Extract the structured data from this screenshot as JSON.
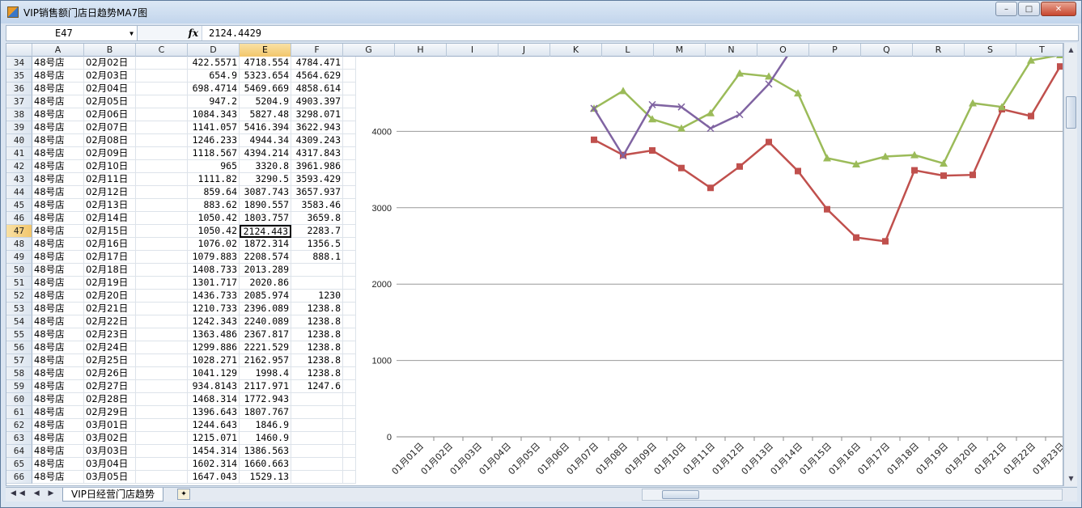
{
  "window": {
    "title": "VIP销售额门店日趋势MA7图",
    "min": "–",
    "max": "□",
    "close": "✕"
  },
  "formula": {
    "cell_ref": "E47",
    "value": "2124.4429",
    "fx": "fx"
  },
  "columns": [
    "A",
    "B",
    "C",
    "D",
    "E",
    "F",
    "G",
    "H",
    "I",
    "J",
    "K",
    "L",
    "M",
    "N",
    "O",
    "P",
    "Q",
    "R",
    "S",
    "T"
  ],
  "selected_column": "E",
  "rows": [
    {
      "n": "34",
      "a": "48号店",
      "b": "02月02日",
      "d": "422.5571",
      "e": "4718.554",
      "f": "4784.471"
    },
    {
      "n": "35",
      "a": "48号店",
      "b": "02月03日",
      "d": "654.9",
      "e": "5323.654",
      "f": "4564.629"
    },
    {
      "n": "36",
      "a": "48号店",
      "b": "02月04日",
      "d": "698.4714",
      "e": "5469.669",
      "f": "4858.614"
    },
    {
      "n": "37",
      "a": "48号店",
      "b": "02月05日",
      "d": "947.2",
      "e": "5204.9",
      "f": "4903.397"
    },
    {
      "n": "38",
      "a": "48号店",
      "b": "02月06日",
      "d": "1084.343",
      "e": "5827.48",
      "f": "3298.071"
    },
    {
      "n": "39",
      "a": "48号店",
      "b": "02月07日",
      "d": "1141.057",
      "e": "5416.394",
      "f": "3622.943"
    },
    {
      "n": "40",
      "a": "48号店",
      "b": "02月08日",
      "d": "1246.233",
      "e": "4944.34",
      "f": "4309.243"
    },
    {
      "n": "41",
      "a": "48号店",
      "b": "02月09日",
      "d": "1118.567",
      "e": "4394.214",
      "f": "4317.843"
    },
    {
      "n": "42",
      "a": "48号店",
      "b": "02月10日",
      "d": "965",
      "e": "3320.8",
      "f": "3961.986"
    },
    {
      "n": "43",
      "a": "48号店",
      "b": "02月11日",
      "d": "1111.82",
      "e": "3290.5",
      "f": "3593.429"
    },
    {
      "n": "44",
      "a": "48号店",
      "b": "02月12日",
      "d": "859.64",
      "e": "3087.743",
      "f": "3657.937"
    },
    {
      "n": "45",
      "a": "48号店",
      "b": "02月13日",
      "d": "883.62",
      "e": "1890.557",
      "f": "3583.46"
    },
    {
      "n": "46",
      "a": "48号店",
      "b": "02月14日",
      "d": "1050.42",
      "e": "1803.757",
      "f": "3659.8"
    },
    {
      "n": "47",
      "a": "48号店",
      "b": "02月15日",
      "d": "1050.42",
      "e": "2124.443",
      "f": "2283.7"
    },
    {
      "n": "48",
      "a": "48号店",
      "b": "02月16日",
      "d": "1076.02",
      "e": "1872.314",
      "f": "1356.5"
    },
    {
      "n": "49",
      "a": "48号店",
      "b": "02月17日",
      "d": "1079.883",
      "e": "2208.574",
      "f": "888.1"
    },
    {
      "n": "50",
      "a": "48号店",
      "b": "02月18日",
      "d": "1408.733",
      "e": "2013.289",
      "f": ""
    },
    {
      "n": "51",
      "a": "48号店",
      "b": "02月19日",
      "d": "1301.717",
      "e": "2020.86",
      "f": ""
    },
    {
      "n": "52",
      "a": "48号店",
      "b": "02月20日",
      "d": "1436.733",
      "e": "2085.974",
      "f": "1230"
    },
    {
      "n": "53",
      "a": "48号店",
      "b": "02月21日",
      "d": "1210.733",
      "e": "2396.089",
      "f": "1238.8"
    },
    {
      "n": "54",
      "a": "48号店",
      "b": "02月22日",
      "d": "1242.343",
      "e": "2240.089",
      "f": "1238.8"
    },
    {
      "n": "55",
      "a": "48号店",
      "b": "02月23日",
      "d": "1363.486",
      "e": "2367.817",
      "f": "1238.8"
    },
    {
      "n": "56",
      "a": "48号店",
      "b": "02月24日",
      "d": "1299.886",
      "e": "2221.529",
      "f": "1238.8"
    },
    {
      "n": "57",
      "a": "48号店",
      "b": "02月25日",
      "d": "1028.271",
      "e": "2162.957",
      "f": "1238.8"
    },
    {
      "n": "58",
      "a": "48号店",
      "b": "02月26日",
      "d": "1041.129",
      "e": "1998.4",
      "f": "1238.8"
    },
    {
      "n": "59",
      "a": "48号店",
      "b": "02月27日",
      "d": "934.8143",
      "e": "2117.971",
      "f": "1247.6"
    },
    {
      "n": "60",
      "a": "48号店",
      "b": "02月28日",
      "d": "1468.314",
      "e": "1772.943",
      "f": ""
    },
    {
      "n": "61",
      "a": "48号店",
      "b": "02月29日",
      "d": "1396.643",
      "e": "1807.767",
      "f": ""
    },
    {
      "n": "62",
      "a": "48号店",
      "b": "03月01日",
      "d": "1244.643",
      "e": "1846.9",
      "f": ""
    },
    {
      "n": "63",
      "a": "48号店",
      "b": "03月02日",
      "d": "1215.071",
      "e": "1460.9",
      "f": ""
    },
    {
      "n": "64",
      "a": "48号店",
      "b": "03月03日",
      "d": "1454.314",
      "e": "1386.563",
      "f": ""
    },
    {
      "n": "65",
      "a": "48号店",
      "b": "03月04日",
      "d": "1602.314",
      "e": "1660.663",
      "f": ""
    },
    {
      "n": "66",
      "a": "48号店",
      "b": "03月05日",
      "d": "1647.043",
      "e": "1529.13",
      "f": ""
    }
  ],
  "active_row": "47",
  "sheet_tab": "VIP日经营门店趋势",
  "chart_data": {
    "type": "line",
    "categories": [
      "01月01日",
      "01月02日",
      "01月03日",
      "01月04日",
      "01月05日",
      "01月06日",
      "01月07日",
      "01月08日",
      "01月09日",
      "01月10日",
      "01月11日",
      "01月12日",
      "01月13日",
      "01月14日",
      "01月15日",
      "01月16日",
      "01月17日",
      "01月18日",
      "01月19日",
      "01月20日",
      "01月21日",
      "01月22日",
      "01月23日"
    ],
    "yticks": [
      "0",
      "1000",
      "2000",
      "3000",
      "4000"
    ],
    "ylim": [
      0,
      5000
    ],
    "series": [
      {
        "color": "#c0504d",
        "marker": "square",
        "values": [
          null,
          null,
          null,
          null,
          null,
          null,
          3890,
          3690,
          3750,
          3520,
          3260,
          3540,
          3860,
          3480,
          2980,
          2610,
          2560,
          3490,
          3420,
          3430,
          4290,
          4200,
          4850,
          4850
        ]
      },
      {
        "color": "#9bbb59",
        "marker": "triangle",
        "values": [
          null,
          null,
          null,
          null,
          null,
          null,
          4300,
          4530,
          4160,
          4040,
          4240,
          4760,
          4720,
          4500,
          3650,
          3570,
          3670,
          3690,
          3580,
          4370,
          4320,
          4930,
          5000,
          5000
        ]
      },
      {
        "color": "#8064a2",
        "marker": "x",
        "values": [
          null,
          null,
          null,
          null,
          null,
          null,
          4300,
          3680,
          4350,
          4320,
          4040,
          4220,
          4620,
          5200
        ]
      }
    ]
  }
}
